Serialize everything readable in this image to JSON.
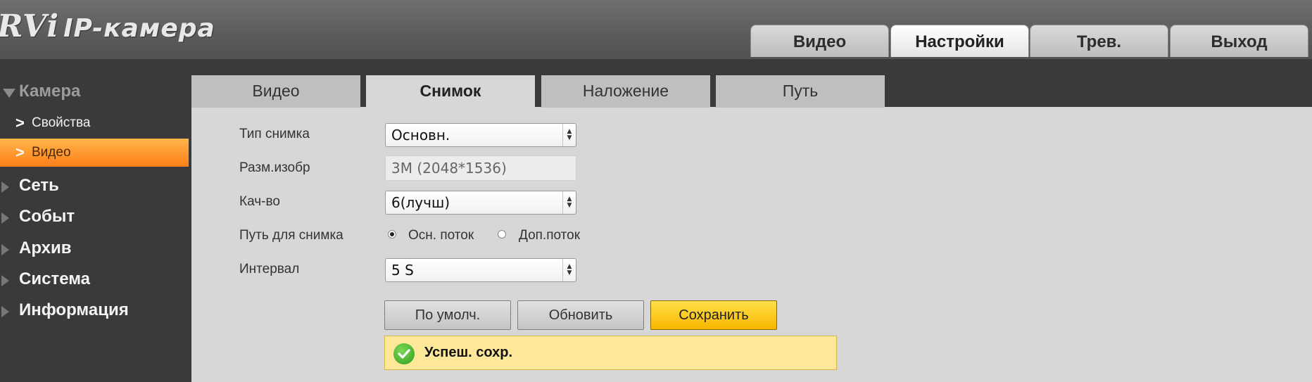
{
  "header": {
    "brand": "RVi",
    "title": "IP-камера",
    "tabs": [
      {
        "label": "Видео",
        "active": false
      },
      {
        "label": "Настройки",
        "active": true
      },
      {
        "label": "Трев.",
        "active": false
      },
      {
        "label": "Выход",
        "active": false
      }
    ]
  },
  "sidebar": {
    "categories": [
      {
        "label": "Камера",
        "expanded": true,
        "items": [
          {
            "label": "Свойства",
            "active": false
          },
          {
            "label": "Видео",
            "active": true
          }
        ]
      },
      {
        "label": "Сеть",
        "expanded": false
      },
      {
        "label": "Событ",
        "expanded": false
      },
      {
        "label": "Архив",
        "expanded": false
      },
      {
        "label": "Система",
        "expanded": false
      },
      {
        "label": "Информация",
        "expanded": false
      }
    ]
  },
  "subtabs": [
    {
      "label": "Видео",
      "active": false
    },
    {
      "label": "Снимок",
      "active": true
    },
    {
      "label": "Наложение",
      "active": false
    },
    {
      "label": "Путь",
      "active": false
    }
  ],
  "form": {
    "snapshot_type": {
      "label": "Тип снимка",
      "value": "Основн."
    },
    "image_size": {
      "label": "Разм.изобр",
      "value": "3M (2048*1536)"
    },
    "quality": {
      "label": "Кач-во",
      "value": "6(лучш)"
    },
    "snapshot_path": {
      "label": "Путь для снимка",
      "options": [
        "Осн. поток",
        "Доп.поток"
      ],
      "selected": "Осн. поток"
    },
    "interval": {
      "label": "Интервал",
      "value": "5 S"
    }
  },
  "buttons": {
    "default": "По умолч.",
    "refresh": "Обновить",
    "save": "Сохранить"
  },
  "message": {
    "text": "Успеш. сохр.",
    "type": "success"
  },
  "colors": {
    "accent": "#ff9a2e",
    "save_button": "#fcc20a",
    "success_bg": "#fde899",
    "success_icon": "#3aa524"
  }
}
